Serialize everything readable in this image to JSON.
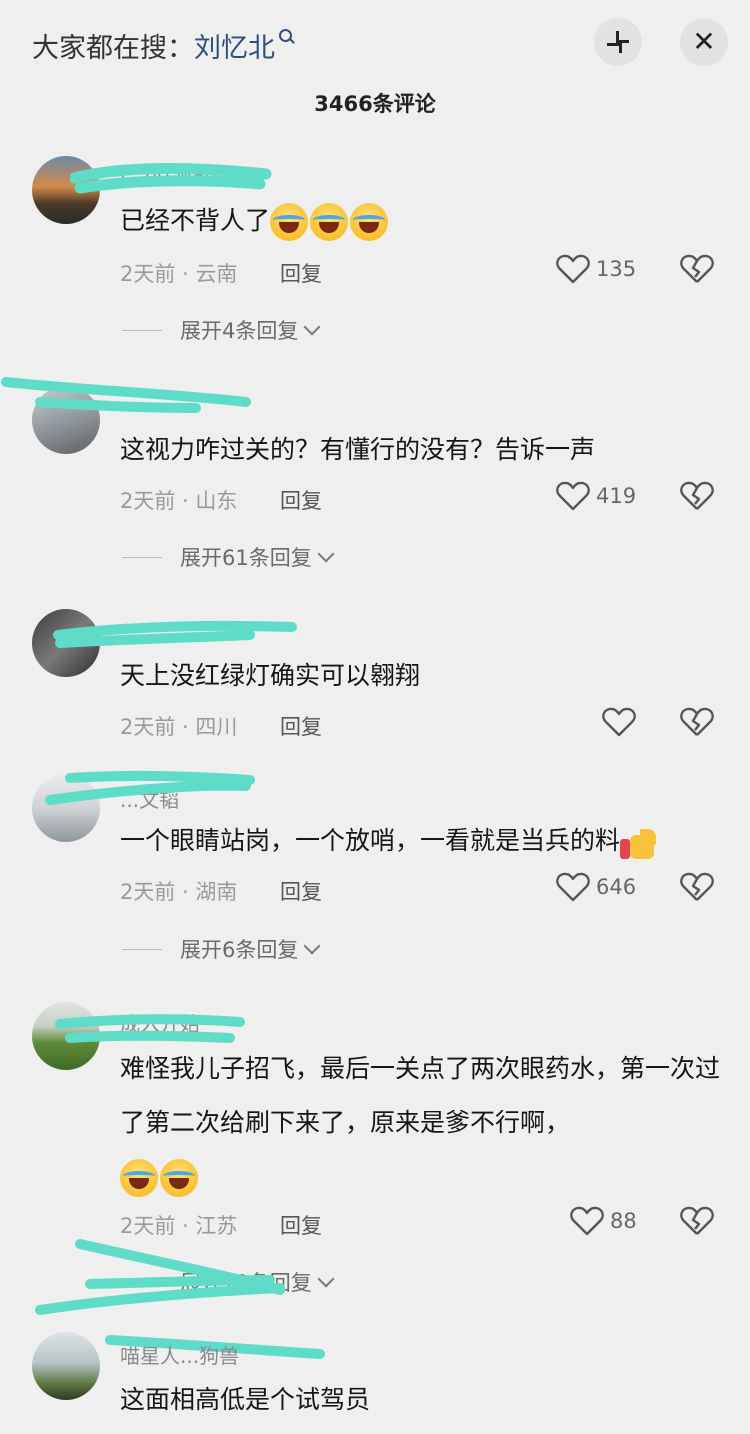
{
  "header": {
    "search_prefix": "大家都在搜：",
    "search_keyword": "刘忆北",
    "comment_count": "3466条评论"
  },
  "comments": [
    {
      "username": "l...no wand",
      "text": "已经不背人了",
      "emoji_count": 3,
      "date": "2天前 · 云南",
      "reply": "回复",
      "likes": "135",
      "expand": "展开4条回复"
    },
    {
      "username": "",
      "text": "这视力咋过关的？有懂行的没有？告诉一声",
      "date": "2天前 · 山东",
      "reply": "回复",
      "likes": "419",
      "expand": "展开61条回复"
    },
    {
      "username": "",
      "text": "天上没红绿灯确实可以翱翔",
      "date": "2天前 · 四川",
      "reply": "回复",
      "likes": ""
    },
    {
      "username": "...文韬",
      "text": "一个眼睛站岗，一个放哨，一看就是当兵的料",
      "date": "2天前 · 湖南",
      "reply": "回复",
      "likes": "646",
      "expand": "展开6条回复"
    },
    {
      "username": "成入开始",
      "text": "难怪我儿子招飞，最后一关点了两次眼药水，第一次过了第二次给刷下来了，原来是爹不行啊，",
      "emoji_count": 2,
      "date": "2天前 · 江苏",
      "reply": "回复",
      "likes": "88",
      "expand": "展开10条回复"
    },
    {
      "username": "喵星人...狗兽",
      "text": "这面相高低是个试驾员"
    }
  ],
  "icons": {
    "like": "heart-outline-icon",
    "dislike": "broken-heart-icon",
    "close": "close-icon",
    "collapse": "collapse-icon"
  },
  "colors": {
    "background": "#efefef",
    "keyword": "#2f4f7a",
    "scribble": "#5fdcc7"
  }
}
